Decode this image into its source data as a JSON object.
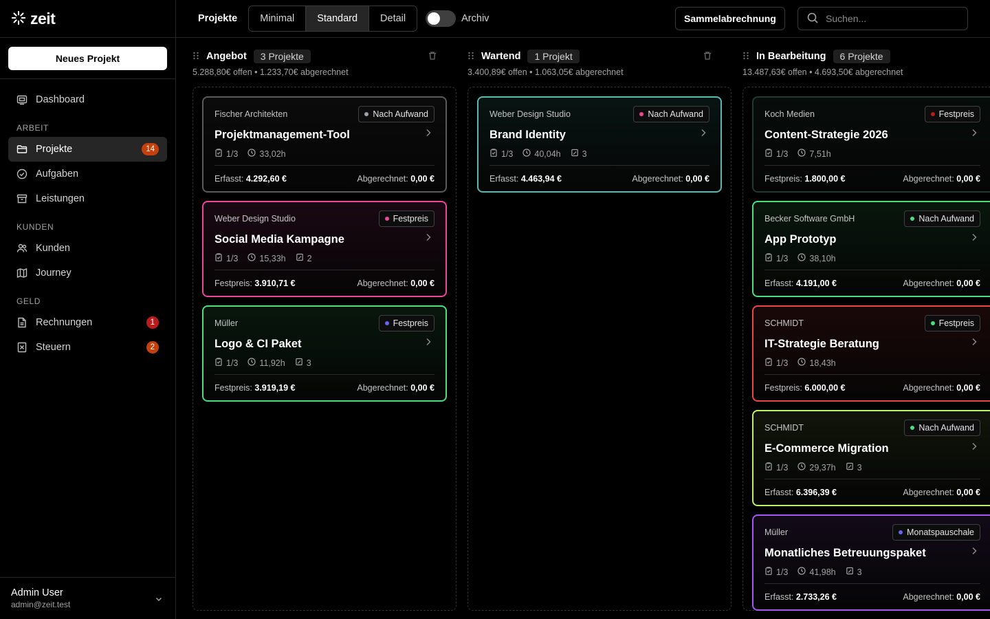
{
  "app": {
    "name": "zeit"
  },
  "sidebar": {
    "new_project_label": "Neues Projekt",
    "dashboard_label": "Dashboard",
    "sections": [
      {
        "title": "ARBEIT",
        "items": [
          {
            "label": "Projekte",
            "badge": "14",
            "icon": "folder-icon",
            "active": true
          },
          {
            "label": "Aufgaben",
            "badge": "",
            "icon": "check-circle-icon"
          },
          {
            "label": "Leistungen",
            "badge": "",
            "icon": "archive-icon"
          }
        ]
      },
      {
        "title": "KUNDEN",
        "items": [
          {
            "label": "Kunden",
            "badge": "",
            "icon": "users-icon"
          },
          {
            "label": "Journey",
            "badge": "",
            "icon": "map-icon"
          }
        ]
      },
      {
        "title": "GELD",
        "items": [
          {
            "label": "Rechnungen",
            "badge": "1",
            "icon": "file-icon"
          },
          {
            "label": "Steuern",
            "badge": "2",
            "icon": "receipt-icon"
          }
        ]
      }
    ],
    "user": {
      "name": "Admin User",
      "email": "admin@zeit.test"
    }
  },
  "topbar": {
    "title": "Projekte",
    "views": [
      "Minimal",
      "Standard",
      "Detail"
    ],
    "active_view": "Standard",
    "archive_label": "Archiv",
    "archive_on": false,
    "sammel_label": "Sammelabrechnung",
    "search_placeholder": "Suchen..."
  },
  "colors": {
    "badge_orange": "#c2410c",
    "badge_red": "#b91c1c",
    "border_gray": "#5a5a5a",
    "border_teal": "#5eb8b0",
    "border_pink": "#ec4899",
    "border_green": "#4ade80",
    "border_red": "#ef4444",
    "border_lime": "#bef264",
    "border_purple": "#a855f7"
  },
  "columns": [
    {
      "title": "Angebot",
      "count": "3 Projekte",
      "summary": "5.288,80€ offen • 1.233,70€ abgerechnet",
      "cards": [
        {
          "client": "Fischer Architekten",
          "tag": "Nach Aufwand",
          "tag_color": "#9ca3af",
          "title": "Projektmanagement-Tool",
          "tasks": "1/3",
          "hours": "33,02h",
          "extra": "",
          "foot_label": "Erfasst:",
          "foot_value": "4.292,60 €",
          "billed_label": "Abgerechnet:",
          "billed_value": "0,00 €",
          "border": "#5a5a5a",
          "bg": "#0b0b0b"
        },
        {
          "client": "Weber Design Studio",
          "tag": "Festpreis",
          "tag_color": "#ec4899",
          "title": "Social Media Kampagne",
          "tasks": "1/3",
          "hours": "15,33h",
          "extra": "2",
          "foot_label": "Festpreis:",
          "foot_value": "3.910,71 €",
          "billed_label": "Abgerechnet:",
          "billed_value": "0,00 €",
          "border": "#ec4899",
          "bg": "#1a0812"
        },
        {
          "client": "Müller",
          "tag": "Festpreis",
          "tag_color": "#6366f1",
          "title": "Logo & CI Paket",
          "tasks": "1/3",
          "hours": "11,92h",
          "extra": "3",
          "foot_label": "Festpreis:",
          "foot_value": "3.919,19 €",
          "billed_label": "Abgerechnet:",
          "billed_value": "0,00 €",
          "border": "#4ade80",
          "bg": "#08170c"
        }
      ]
    },
    {
      "title": "Wartend",
      "count": "1 Projekt",
      "summary": "3.400,89€ offen • 1.063,05€ abgerechnet",
      "cards": [
        {
          "client": "Weber Design Studio",
          "tag": "Nach Aufwand",
          "tag_color": "#ec4899",
          "title": "Brand Identity",
          "tasks": "1/3",
          "hours": "40,04h",
          "extra": "3",
          "foot_label": "Erfasst:",
          "foot_value": "4.463,94 €",
          "billed_label": "Abgerechnet:",
          "billed_value": "0,00 €",
          "border": "#5eb8b0",
          "bg": "#081513"
        }
      ]
    },
    {
      "title": "In Bearbeitung",
      "count": "6 Projekte",
      "summary": "13.487,63€ offen • 4.693,50€ abgerechnet",
      "cards": [
        {
          "client": "Koch Medien",
          "tag": "Festpreis",
          "tag_color": "#b91c1c",
          "title": "Content-Strategie 2026",
          "tasks": "1/3",
          "hours": "7,51h",
          "extra": "",
          "foot_label": "Festpreis:",
          "foot_value": "1.800,00 €",
          "billed_label": "Abgerechnet:",
          "billed_value": "0,00 €",
          "border": "#1f3a33",
          "bg": "#070d0b"
        },
        {
          "client": "Becker Software GmbH",
          "tag": "Nach Aufwand",
          "tag_color": "#4ade80",
          "title": "App Prototyp",
          "tasks": "1/3",
          "hours": "38,10h",
          "extra": "",
          "foot_label": "Erfasst:",
          "foot_value": "4.191,00 €",
          "billed_label": "Abgerechnet:",
          "billed_value": "0,00 €",
          "border": "#4ade80",
          "bg": "#08170c"
        },
        {
          "client": "SCHMIDT",
          "tag": "Festpreis",
          "tag_color": "#4ade80",
          "title": "IT-Strategie Beratung",
          "tasks": "1/3",
          "hours": "18,43h",
          "extra": "",
          "foot_label": "Festpreis:",
          "foot_value": "6.000,00 €",
          "billed_label": "Abgerechnet:",
          "billed_value": "0,00 €",
          "border": "#ef4444",
          "bg": "#1a0808"
        },
        {
          "client": "SCHMIDT",
          "tag": "Nach Aufwand",
          "tag_color": "#4ade80",
          "title": "E-Commerce Migration",
          "tasks": "1/3",
          "hours": "29,37h",
          "extra": "3",
          "foot_label": "Erfasst:",
          "foot_value": "6.396,39 €",
          "billed_label": "Abgerechnet:",
          "billed_value": "0,00 €",
          "border": "#bef264",
          "bg": "#11150a"
        },
        {
          "client": "Müller",
          "tag": "Monatspauschale",
          "tag_color": "#6366f1",
          "title": "Monatliches Betreuungspaket",
          "tasks": "1/3",
          "hours": "41,98h",
          "extra": "3",
          "foot_label": "Erfasst:",
          "foot_value": "2.733,26 €",
          "billed_label": "Abgerechnet:",
          "billed_value": "0,00 €",
          "border": "#a855f7",
          "bg": "#120a18"
        }
      ]
    }
  ]
}
